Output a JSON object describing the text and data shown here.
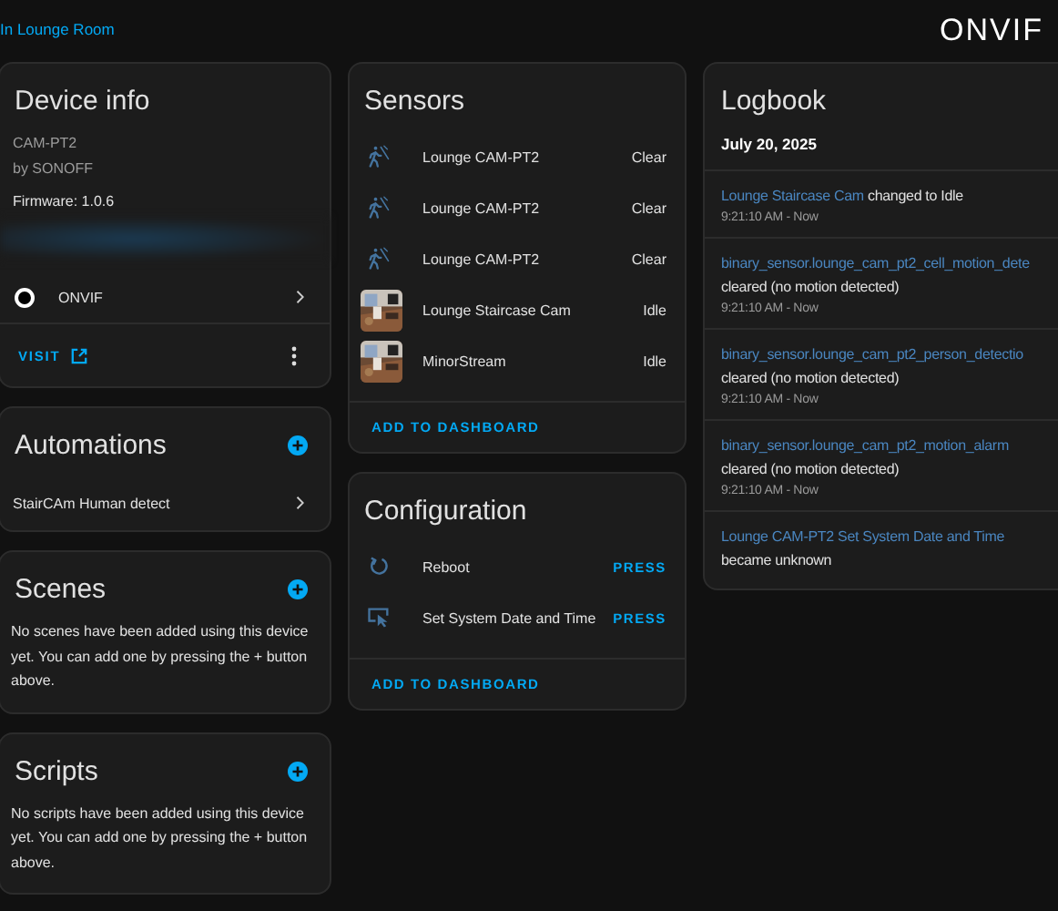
{
  "breadcrumb": "In Lounge Room",
  "logo": "ONVIF",
  "device_info": {
    "title": "Device info",
    "model": "CAM-PT2",
    "manufacturer": "by SONOFF",
    "firmware": "Firmware: 1.0.6",
    "integration": "ONVIF",
    "visit": "VISIT"
  },
  "automations": {
    "title": "Automations",
    "items": [
      "StairCAm Human detect"
    ]
  },
  "scenes": {
    "title": "Scenes",
    "empty_text": "No scenes have been added using this device yet. You can add one by pressing the + button above."
  },
  "scripts": {
    "title": "Scripts",
    "empty_text": "No scripts have been added using this device yet. You can add one by pressing the + button above."
  },
  "sensors": {
    "title": "Sensors",
    "items": [
      {
        "kind": "motion",
        "name": "Lounge CAM-PT2",
        "state": "Clear"
      },
      {
        "kind": "motion",
        "name": "Lounge CAM-PT2",
        "state": "Clear"
      },
      {
        "kind": "motion",
        "name": "Lounge CAM-PT2",
        "state": "Clear"
      },
      {
        "kind": "camera",
        "name": "Lounge Staircase Cam",
        "state": "Idle"
      },
      {
        "kind": "camera",
        "name": "MinorStream",
        "state": "Idle"
      }
    ],
    "action": "ADD TO DASHBOARD"
  },
  "configuration": {
    "title": "Configuration",
    "items": [
      {
        "kind": "reboot",
        "name": "Reboot",
        "action": "PRESS"
      },
      {
        "kind": "datetime",
        "name": "Set System Date and Time",
        "action": "PRESS"
      }
    ],
    "action": "ADD TO DASHBOARD"
  },
  "logbook": {
    "title": "Logbook",
    "date": "July 20, 2025",
    "entries": [
      {
        "entity": "Lounge Staircase Cam",
        "message": "changed to Idle",
        "time": "9:21:10 AM - Now"
      },
      {
        "entity": "binary_sensor.lounge_cam_pt2_cell_motion_dete",
        "message": "cleared (no motion detected)",
        "time": "9:21:10 AM - Now"
      },
      {
        "entity": "binary_sensor.lounge_cam_pt2_person_detectio",
        "message": "cleared (no motion detected)",
        "time": "9:21:10 AM - Now"
      },
      {
        "entity": "binary_sensor.lounge_cam_pt2_motion_alarm",
        "message": "cleared (no motion detected)",
        "time": "9:21:10 AM - Now"
      },
      {
        "entity": "Lounge CAM-PT2 Set System Date and Time",
        "message": "became unknown"
      }
    ]
  }
}
